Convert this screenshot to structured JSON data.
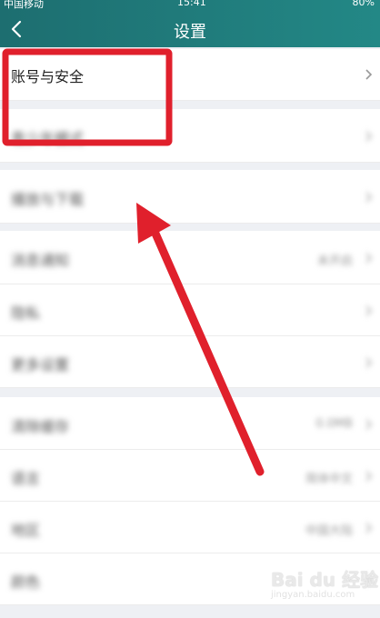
{
  "status": {
    "carrier": "中国移动",
    "time": "15:41",
    "battery": "80%"
  },
  "header": {
    "title": "设置"
  },
  "rows": [
    {
      "label": "账号与安全",
      "value": ""
    },
    {
      "label": "青少年模式",
      "value": ""
    },
    {
      "label": "播放与下载",
      "value": ""
    },
    {
      "label": "消息通知",
      "value": "未开启"
    },
    {
      "label": "隐私",
      "value": ""
    },
    {
      "label": "更多设置",
      "value": ""
    },
    {
      "label": "清除缓存",
      "value": "0.0MB"
    },
    {
      "label": "语言",
      "value": "简体中文"
    },
    {
      "label": "地区",
      "value": "中国大陆"
    },
    {
      "label": "颜色",
      "value": ""
    }
  ],
  "watermark": {
    "main": "Bai du 经验",
    "sub": "jingyan.baidu.com"
  },
  "annotation": {
    "color": "#e0202c"
  }
}
